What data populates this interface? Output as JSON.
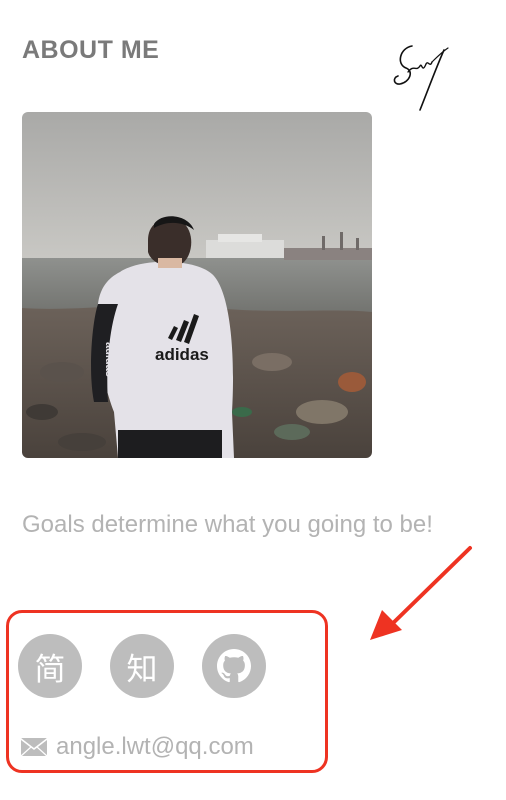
{
  "about": {
    "title": "ABOUT ME",
    "bio": "Goals determine what you going to be!"
  },
  "photo": {
    "shirt_text": "adidas",
    "sleeve_text": "adidas"
  },
  "social": {
    "jianshu_label": "简",
    "zhihu_label": "知",
    "github_icon": "github-icon"
  },
  "contact": {
    "email": "angle.lwt@qq.com",
    "email_icon": "envelope-icon"
  },
  "colors": {
    "highlight": "#ee3322",
    "social_bg": "#bdbdbd",
    "text_muted": "#b3b3b3"
  }
}
